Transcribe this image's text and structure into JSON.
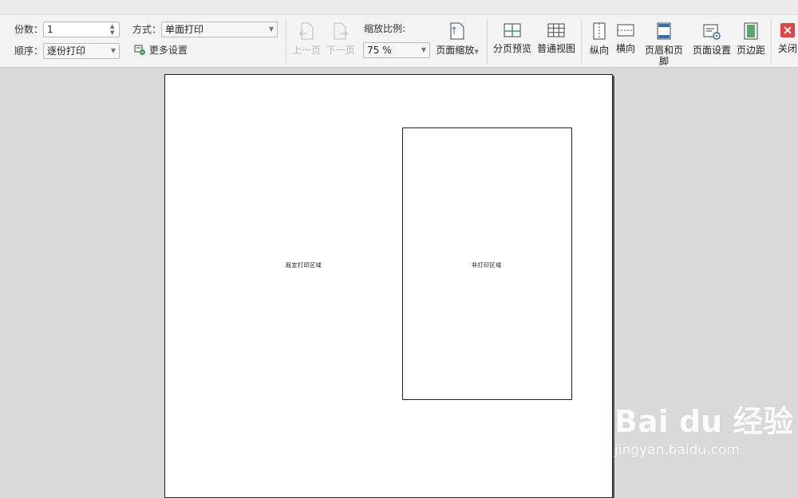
{
  "toolbar": {
    "copies_label": "份数：",
    "copies_value": "1",
    "order_label": "顺序：",
    "order_value": "逐份打印",
    "mode_label": "方式：",
    "mode_value": "单面打印",
    "more_settings": "更多设置",
    "prev_page": "上一页",
    "next_page": "下一页",
    "zoom_label": "缩放比例:",
    "zoom_value": "75 %",
    "page_zoom": "页面缩放",
    "page_break_preview": "分页预览",
    "normal_view": "普通视图",
    "portrait": "纵向",
    "landscape": "横向",
    "header_footer": "页眉和页脚",
    "page_setup": "页面设置",
    "margins": "页边距",
    "close": "关闭"
  },
  "page": {
    "print_area_label": "既定打印区域",
    "non_print_area_label": "非打印区域"
  },
  "watermark": {
    "brand": "Bai du 经验",
    "url": "jingyan.baidu.com"
  },
  "colors": {
    "close_red": "#e04343",
    "active_gray": "#c4c4c4",
    "icon_green": "#3a9b55",
    "icon_blue": "#2f6fb5"
  }
}
